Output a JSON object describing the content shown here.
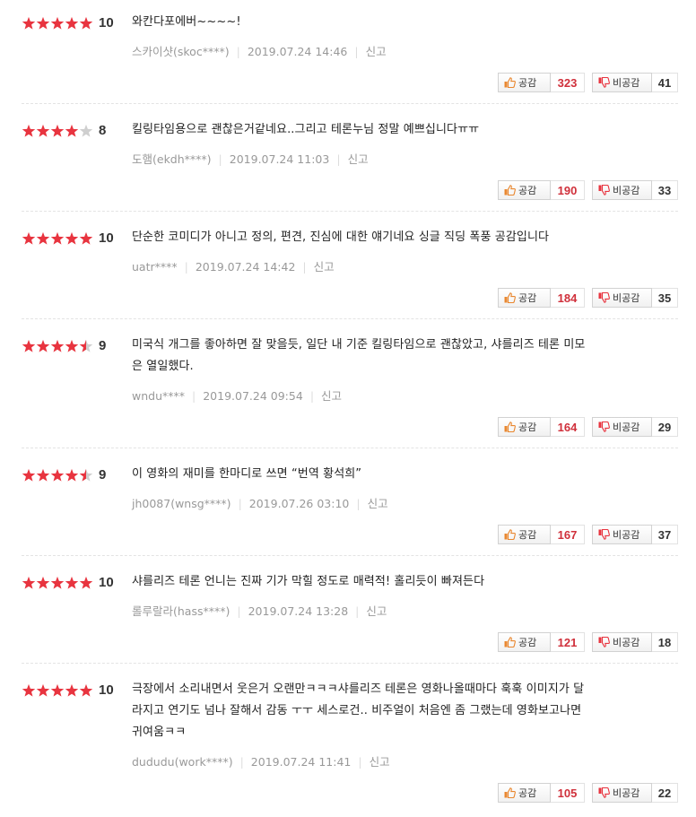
{
  "colors": {
    "star_on": "#e8343f",
    "star_off": "#cfcfcf",
    "like_count": "#d0303b",
    "dislike_count": "#333333",
    "thumb_up": "#e9872f",
    "thumb_down": "#e8343f"
  },
  "labels": {
    "like": "공감",
    "dislike": "비공감",
    "report": "신고"
  },
  "reviews": [
    {
      "stars": 5,
      "score": "10",
      "lines": [
        "와칸다포에버~~~~!"
      ],
      "user": "스카이샷(skoc****)",
      "date": "2019.07.24 14:46",
      "likes": "323",
      "dislikes": "41"
    },
    {
      "stars": 4,
      "score": "8",
      "lines": [
        "킬링타임용으로 괜찮은거같네요..그리고 테론누님 정말 예쁘십니다ㅠㅠ"
      ],
      "user": "도햄(ekdh****)",
      "date": "2019.07.24 11:03",
      "likes": "190",
      "dislikes": "33"
    },
    {
      "stars": 5,
      "score": "10",
      "lines": [
        "단순한 코미디가 아니고 정의, 편견, 진심에 대한 얘기네요 싱글 직딩 폭풍 공감입니다"
      ],
      "user": "uatr****",
      "date": "2019.07.24 14:42",
      "likes": "184",
      "dislikes": "35"
    },
    {
      "stars": 4.5,
      "score": "9",
      "lines": [
        "미국식 개그를 좋아하면 잘 맞을듯, 일단 내 기준 킬링타임으로 괜찮았고, 샤를리즈 테론 미모",
        "은 열일했다."
      ],
      "user": "wndu****",
      "date": "2019.07.24 09:54",
      "likes": "164",
      "dislikes": "29"
    },
    {
      "stars": 4.5,
      "score": "9",
      "lines": [
        "이 영화의 재미를 한마디로 쓰면 “번역 황석희”"
      ],
      "user": "jh0087(wnsg****)",
      "date": "2019.07.26 03:10",
      "likes": "167",
      "dislikes": "37"
    },
    {
      "stars": 5,
      "score": "10",
      "lines": [
        "샤를리즈 테론 언니는 진짜 기가 막힐 정도로 매력적! 홀리듯이 빠져든다"
      ],
      "user": "롤루랄라(hass****)",
      "date": "2019.07.24 13:28",
      "likes": "121",
      "dislikes": "18"
    },
    {
      "stars": 5,
      "score": "10",
      "lines": [
        "극장에서 소리내면서 웃은거 오랜만ㅋㅋㅋ샤를리즈 테론은 영화나올때마다 훅훅 이미지가 달",
        "라지고 연기도 넘나 잘해서 감동 ㅜㅜ 세스로건.. 비주얼이 처음엔 좀 그랬는데 영화보고나면",
        "귀여움ㅋㅋ"
      ],
      "user": "dududu(work****)",
      "date": "2019.07.24 11:41",
      "likes": "105",
      "dislikes": "22"
    }
  ]
}
